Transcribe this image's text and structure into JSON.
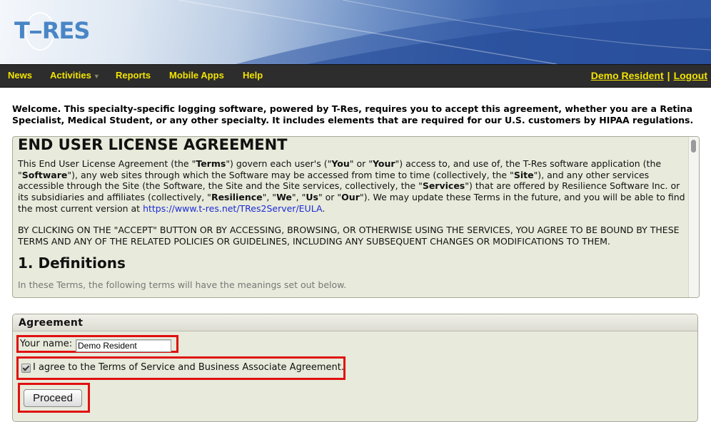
{
  "brand": {
    "logo_text_left": "T",
    "logo_text_right": "RES"
  },
  "nav": {
    "items": [
      {
        "label": "News"
      },
      {
        "label": "Activities",
        "has_dropdown": true
      },
      {
        "label": "Reports"
      },
      {
        "label": "Mobile Apps"
      },
      {
        "label": "Help"
      }
    ],
    "user": "Demo Resident",
    "separator": "|",
    "logout": "Logout"
  },
  "welcome": "Welcome. This specialty-specific logging software, powered by T-Res, requires you to accept this agreement, whether you are a Retina Specialist, Medical Student, or any other specialty. It includes elements that are required for our U.S. customers by HIPAA regulations.",
  "eula": {
    "title": "END USER LICENSE AGREEMENT",
    "p1": {
      "a": "This End User License Agreement (the \"",
      "b": "Terms",
      "c": "\") govern each user's (\"",
      "d": "You",
      "e": "\" or \"",
      "f": "Your",
      "g": "\") access to, and use of, the T-Res software application (the \"",
      "h": "Software",
      "i": "\"), any web sites through which the Software may be accessed from time to time (collectively, the \"",
      "j": "Site",
      "k": "\"), and any other services accessible through the Site (the Software, the Site and the Site services, collectively, the \"",
      "l": "Services",
      "m": "\") that are offered by Resilience Software Inc. or its subsidiaries and affiliates (collectively, \"",
      "n": "Resilience",
      "o": "\", \"",
      "p": "We",
      "q": "\", \"",
      "r": "Us",
      "s": "\" or \"",
      "t": "Our",
      "u": "\"). We may update these Terms in the future, and you will be able to find the most current version at ",
      "link": "https://www.t-res.net/TRes2Server/EULA",
      "v": "."
    },
    "p2": "BY CLICKING ON THE \"ACCEPT\" BUTTON OR BY ACCESSING, BROWSING, OR OTHERWISE USING THE SERVICES, YOU AGREE TO BE BOUND BY THESE TERMS AND ANY OF THE RELATED POLICIES OR GUIDELINES, INCLUDING ANY SUBSEQUENT CHANGES OR MODIFICATIONS TO THEM.",
    "section1": "1. Definitions",
    "cut_line": "In these Terms, the following terms will have the meanings set out below."
  },
  "agreement": {
    "title": "Agreement",
    "name_label": "Your name:",
    "name_value": "Demo Resident",
    "checkbox_checked": true,
    "checkbox_label": "I agree to the Terms of Service and Business Associate Agreement.",
    "proceed_label": "Proceed"
  },
  "colors": {
    "nav_bg": "#2d2d2d",
    "nav_text": "#f2e400",
    "panel_bg": "#e8eadb",
    "highlight": "#e01010",
    "link": "#1a2bd8"
  }
}
